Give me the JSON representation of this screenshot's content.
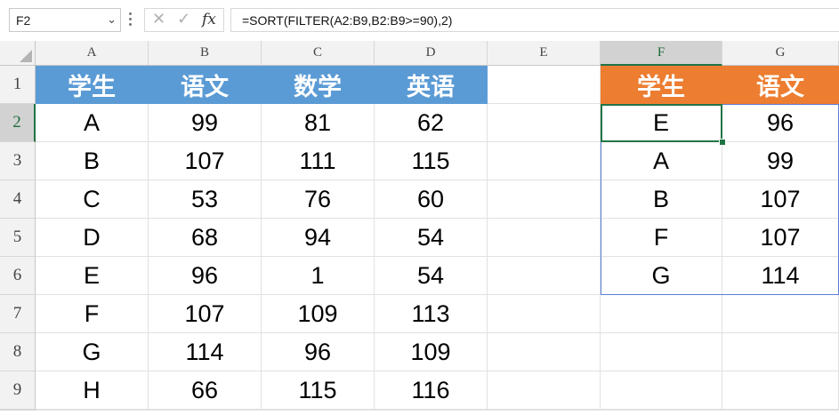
{
  "formula_bar": {
    "name_box": "F2",
    "cancel_glyph": "✕",
    "enter_glyph": "✓",
    "fx_label": "fx",
    "formula": "=SORT(FILTER(A2:B9,B2:B9>=90),2)"
  },
  "columns": [
    "A",
    "B",
    "C",
    "D",
    "E",
    "F",
    "G"
  ],
  "rows": [
    "1",
    "2",
    "3",
    "4",
    "5",
    "6",
    "7",
    "8",
    "9"
  ],
  "selected": {
    "column": "F",
    "row": "2"
  },
  "colors": {
    "header_blue": "#5b9bd5",
    "header_orange": "#ed7d31",
    "selection_green": "#217346",
    "spill_border": "#5b7fd6"
  },
  "table": {
    "headers": [
      "学生",
      "语文",
      "数学",
      "英语"
    ],
    "rows": [
      [
        "A",
        "99",
        "81",
        "62"
      ],
      [
        "B",
        "107",
        "111",
        "115"
      ],
      [
        "C",
        "53",
        "76",
        "60"
      ],
      [
        "D",
        "68",
        "94",
        "54"
      ],
      [
        "E",
        "96",
        "1",
        "54"
      ],
      [
        "F",
        "107",
        "109",
        "113"
      ],
      [
        "G",
        "114",
        "96",
        "109"
      ],
      [
        "H",
        "66",
        "115",
        "116"
      ]
    ]
  },
  "result": {
    "headers": [
      "学生",
      "语文"
    ],
    "rows": [
      [
        "E",
        "96"
      ],
      [
        "A",
        "99"
      ],
      [
        "B",
        "107"
      ],
      [
        "F",
        "107"
      ],
      [
        "G",
        "114"
      ]
    ]
  }
}
